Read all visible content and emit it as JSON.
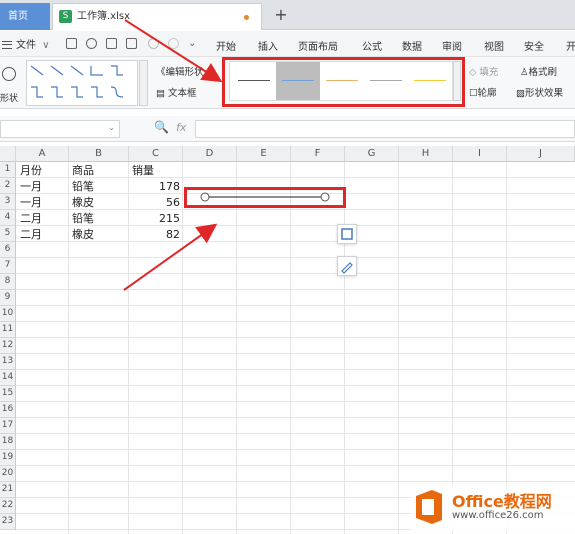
{
  "tabs": {
    "home": "首页",
    "file": "工作簿.xlsx",
    "file_icon": "S",
    "add": "+"
  },
  "menu": {
    "file": "文件",
    "file_chevron": "∨",
    "tabs": [
      "开始",
      "插入",
      "页面布局",
      "公式",
      "数据",
      "审阅",
      "视图",
      "安全",
      "开"
    ]
  },
  "ribbon": {
    "shape_label": "形状",
    "edit_shape": "编辑形状",
    "text_box": "文本框",
    "fill": "填充",
    "format_painter": "格式刷",
    "outline": "轮廓",
    "shape_effect": "形状效果",
    "line_styles": [
      {
        "color": "#555555"
      },
      {
        "color": "#6fa0d8"
      },
      {
        "color": "#e8b26a"
      },
      {
        "color": "#a9a9a9"
      },
      {
        "color": "#f0cc3e"
      }
    ]
  },
  "formula_bar": {
    "fx": "fx",
    "value": ""
  },
  "sheet": {
    "columns": [
      "A",
      "B",
      "C",
      "D",
      "E",
      "F",
      "G",
      "H",
      "I",
      "J"
    ],
    "rows": [
      "1",
      "2",
      "3",
      "4",
      "5",
      "6",
      "7",
      "8",
      "9",
      "10",
      "11",
      "12",
      "13",
      "14",
      "15",
      "16",
      "17",
      "18",
      "19",
      "20",
      "21",
      "22",
      "23"
    ],
    "header": [
      "月份",
      "商品",
      "销量"
    ],
    "data": [
      [
        "一月",
        "铅笔",
        "178"
      ],
      [
        "一月",
        "橡皮",
        "56"
      ],
      [
        "二月",
        "铅笔",
        "215"
      ],
      [
        "二月",
        "橡皮",
        "82"
      ]
    ]
  },
  "colors": {
    "highlight": "#e02727",
    "home_tab": "#5b8fd6",
    "watermark": "#e8680e"
  },
  "watermark": {
    "title": "Office教程网",
    "url": "www.office26.com"
  }
}
